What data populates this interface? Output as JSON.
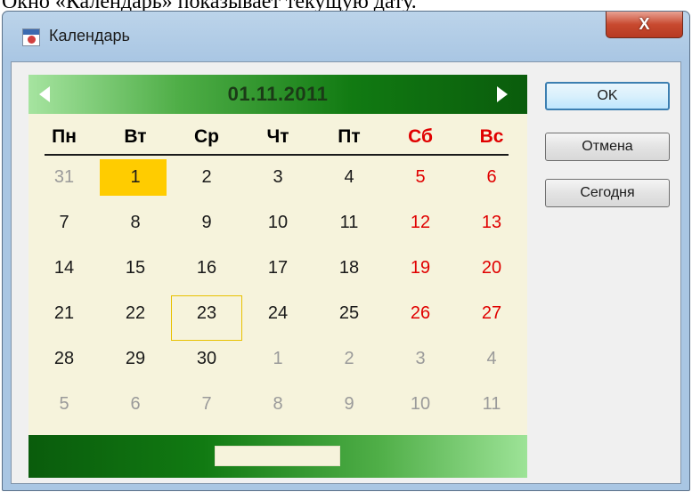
{
  "caption": "Окно «Календарь» показывает текущую дату.",
  "window": {
    "title": "Календарь",
    "icon": "calendar-app-icon",
    "close_label": "X"
  },
  "calendar": {
    "header": "01.11.2011",
    "weekdays": [
      "Пн",
      "Вт",
      "Ср",
      "Чт",
      "Пт",
      "Сб",
      "Вс"
    ],
    "weeks": [
      [
        "31",
        "1",
        "2",
        "3",
        "4",
        "5",
        "6"
      ],
      [
        "7",
        "8",
        "9",
        "10",
        "11",
        "12",
        "13"
      ],
      [
        "14",
        "15",
        "16",
        "17",
        "18",
        "19",
        "20"
      ],
      [
        "21",
        "22",
        "23",
        "24",
        "25",
        "26",
        "27"
      ],
      [
        "28",
        "29",
        "30",
        "1",
        "2",
        "3",
        "4"
      ],
      [
        "5",
        "6",
        "7",
        "8",
        "9",
        "10",
        "11"
      ]
    ],
    "selected_day": "1",
    "today_day": "23",
    "colors": {
      "weekend": "#e00000",
      "other_month": "#9a9a9a",
      "selected": "#ffcc00",
      "today_border": "#e8c100",
      "background": "#f6f3dc",
      "nav_green": "#117a12"
    }
  },
  "buttons": {
    "ok": "OK",
    "cancel": "Отмена",
    "today": "Сегодня"
  }
}
